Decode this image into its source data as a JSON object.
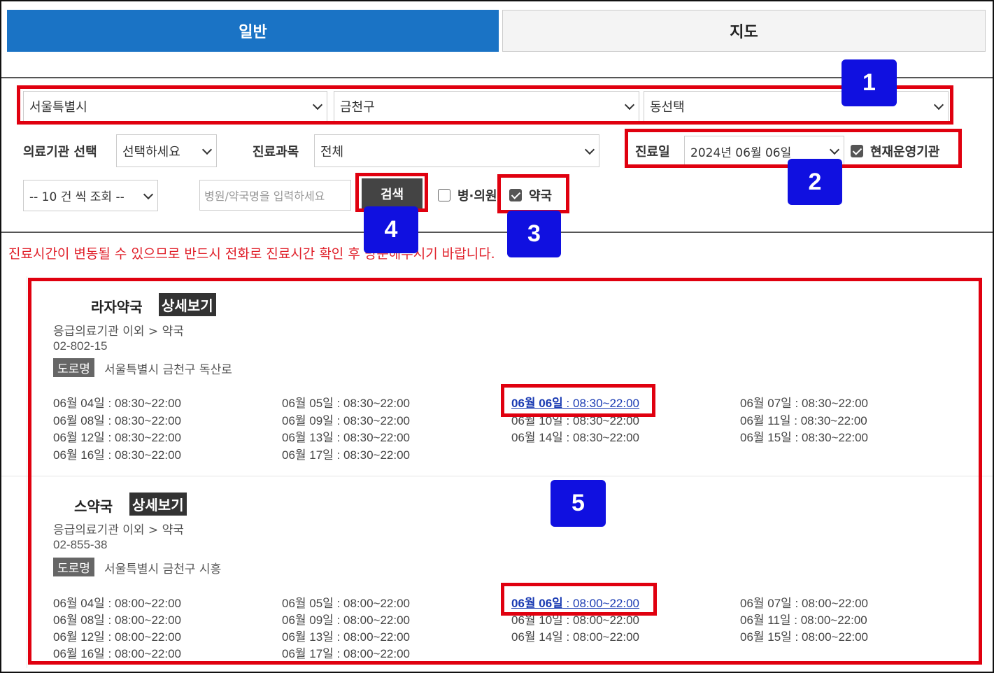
{
  "tabs": {
    "general": "일반",
    "map": "지도"
  },
  "region": {
    "city": "서울특별시",
    "district": "금천구",
    "dong": "동선택"
  },
  "filters": {
    "institution_label": "의료기관 선택",
    "institution_value": "선택하세요",
    "department_label": "진료과목",
    "department_value": "전체",
    "date_label": "진료일",
    "date_value": "2024년 06월 06일",
    "operating_label": "현재운영기관",
    "page_size": "-- 10 건 씩 조회 --",
    "search_placeholder": "병원/약국명을 입력하세요",
    "search_button": "검색",
    "hospital_label": "병·의원",
    "pharmacy_label": "약국"
  },
  "notice": "진료시간이 변동될 수 있으므로 반드시 전화로 진료시간 확인 후 방문해주시기 바랍니다.",
  "badges": [
    "1",
    "2",
    "3",
    "4",
    "5"
  ],
  "results": [
    {
      "name": "라자약국",
      "detail": "상세보기",
      "category": "응급의료기관 이외 > 약국",
      "phone": "02-802-15",
      "road_tag": "도로명",
      "address": "서울특별시 금천구 독산로",
      "hours": [
        [
          "06월 04일 : 08:30~22:00",
          "06월 05일 : 08:30~22:00",
          "06월 06일 : 08:30~22:00",
          "06월 07일 : 08:30~22:00"
        ],
        [
          "06월 08일 : 08:30~22:00",
          "06월 09일 : 08:30~22:00",
          "06월 10일 : 08:30~22:00",
          "06월 11일 : 08:30~22:00"
        ],
        [
          "06월 12일 : 08:30~22:00",
          "06월 13일 : 08:30~22:00",
          "06월 14일 : 08:30~22:00",
          "06월 15일 : 08:30~22:00"
        ],
        [
          "06월 16일 : 08:30~22:00",
          "06월 17일 : 08:30~22:00"
        ]
      ],
      "today_date": "06월 06일",
      "today_time": " : 08:30~22:00"
    },
    {
      "name": "스약국",
      "detail": "상세보기",
      "category": "응급의료기관 이외 > 약국",
      "phone": "02-855-38",
      "road_tag": "도로명",
      "address": "서울특별시 금천구 시흥",
      "hours": [
        [
          "06월 04일 : 08:00~22:00",
          "06월 05일 : 08:00~22:00",
          "06월 06일 : 08:00~22:00",
          "06월 07일 : 08:00~22:00"
        ],
        [
          "06월 08일 : 08:00~22:00",
          "06월 09일 : 08:00~22:00",
          "06월 10일 : 08:00~22:00",
          "06월 11일 : 08:00~22:00"
        ],
        [
          "06월 12일 : 08:00~22:00",
          "06월 13일 : 08:00~22:00",
          "06월 14일 : 08:00~22:00",
          "06월 15일 : 08:00~22:00"
        ],
        [
          "06월 16일 : 08:00~22:00",
          "06월 17일 : 08:00~22:00"
        ]
      ],
      "today_date": "06월 06일",
      "today_time": " : 08:00~22:00"
    }
  ]
}
